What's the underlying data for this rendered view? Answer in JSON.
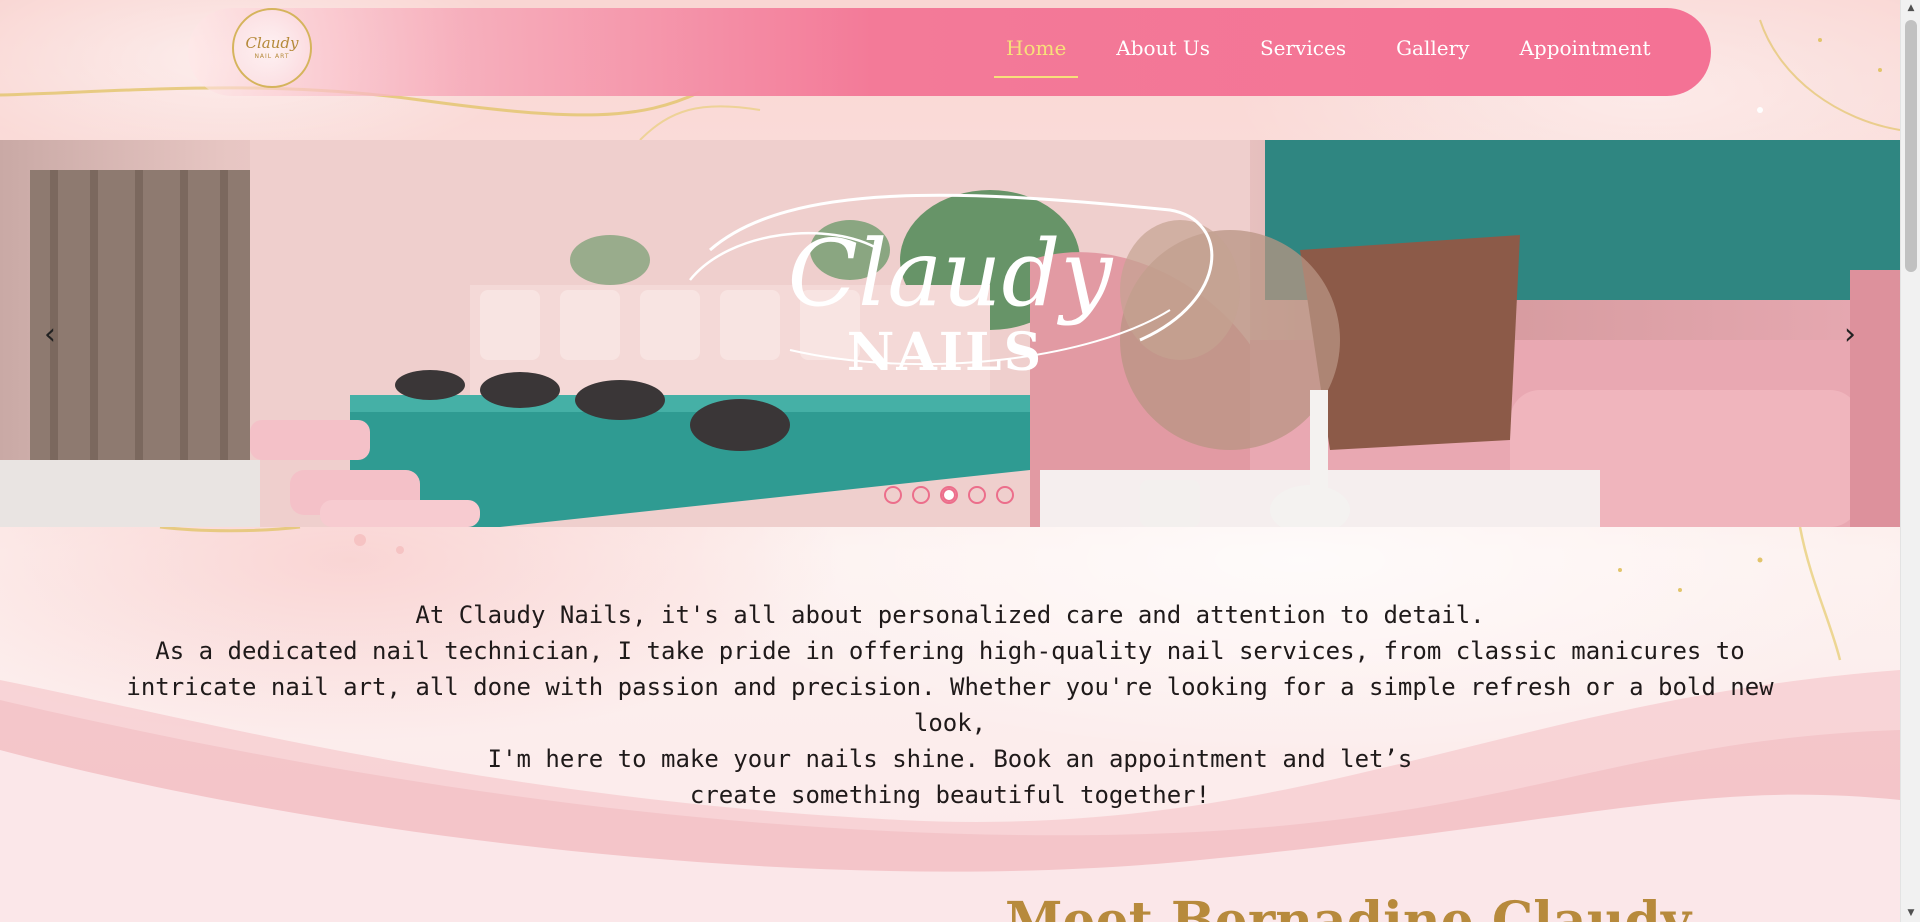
{
  "nav": {
    "logo_script": "Claudy",
    "logo_sub": "NAIL ART",
    "links": [
      {
        "label": "Home",
        "active": true
      },
      {
        "label": "About Us",
        "active": false
      },
      {
        "label": "Services",
        "active": false
      },
      {
        "label": "Gallery",
        "active": false
      },
      {
        "label": "Appointment",
        "active": false
      }
    ]
  },
  "hero": {
    "script_text": "Claudy",
    "brand_text": "NAILS",
    "prev_icon": "‹",
    "next_icon": "›",
    "slide_count": 5,
    "active_slide": 3
  },
  "intro": {
    "line1": "At Claudy Nails, it's all about personalized care and attention to detail.",
    "line2": "As a dedicated nail technician, I take pride in offering high-quality nail services, from classic manicures to",
    "line3": "intricate nail art, all done with passion and precision. Whether you're looking for a simple refresh or a bold new look,",
    "line4": "I'm here to make your nails shine. Book an appointment and let’s",
    "line5": "create something beautiful together!"
  },
  "section": {
    "heading_partial": "Meet Bernadine Claudy"
  },
  "colors": {
    "nav_pink": "#f47295",
    "active_gold": "#f7e07a",
    "dot_pink": "#ec6e8b",
    "heading_gold": "#b78a3c"
  }
}
